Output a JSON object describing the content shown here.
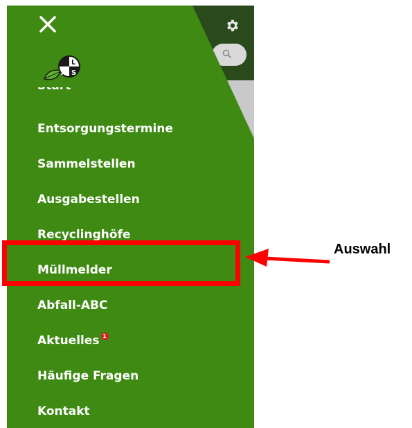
{
  "drawer": {
    "start_label": "Start",
    "items": [
      {
        "label": "Entsorgungstermine"
      },
      {
        "label": "Sammelstellen"
      },
      {
        "label": "Ausgabestellen"
      },
      {
        "label": "Recyclinghöfe"
      },
      {
        "label": "Müllmelder"
      },
      {
        "label": "Abfall-ABC"
      },
      {
        "label": "Aktuelles",
        "badge": "1"
      },
      {
        "label": "Häufige Fragen"
      },
      {
        "label": "Kontakt"
      }
    ],
    "selected_item": "Müllmelder"
  },
  "icons": {
    "close": "close-icon",
    "settings": "gear-icon",
    "search": "search-icon",
    "logo": "als-logo"
  },
  "annotation": {
    "label": "Auswahl"
  },
  "colors": {
    "drawer_background": "#3e8a13",
    "header_background": "#2a4a1c",
    "highlight": "#ff0000",
    "badge": "#d91f1f"
  }
}
